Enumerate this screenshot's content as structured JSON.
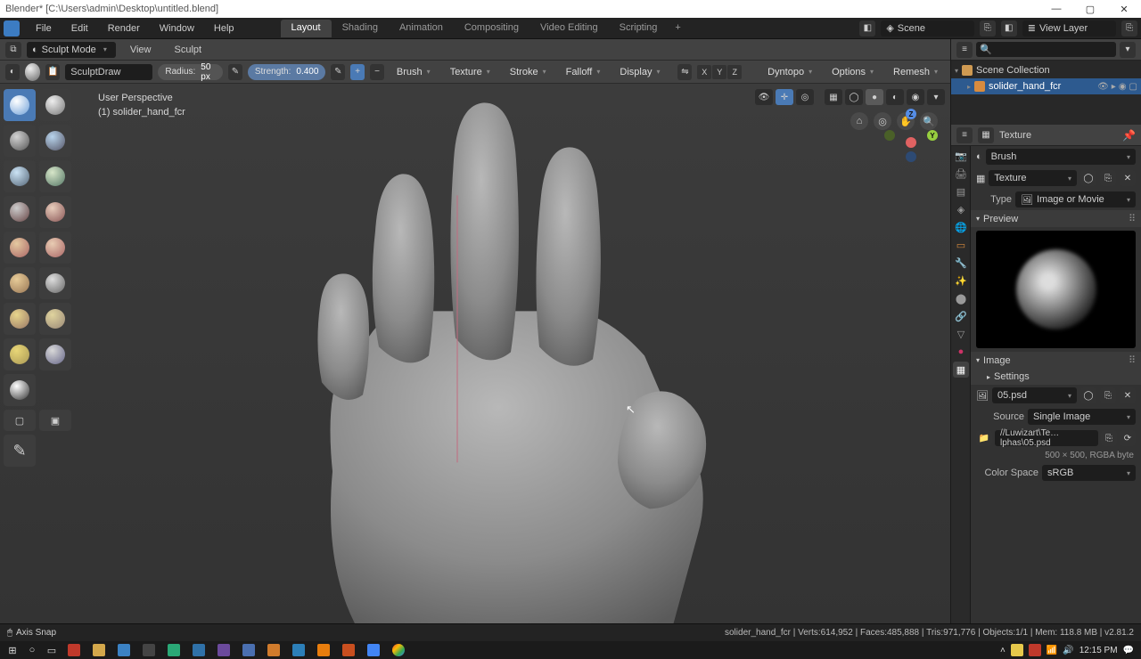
{
  "window": {
    "title": "Blender* [C:\\Users\\admin\\Desktop\\untitled.blend]"
  },
  "menu": [
    "File",
    "Edit",
    "Render",
    "Window",
    "Help"
  ],
  "workspaces": [
    "Layout",
    "Shading",
    "Animation",
    "Compositing",
    "Video Editing",
    "Scripting"
  ],
  "active_workspace": "Layout",
  "scene_field": "Scene",
  "viewlayer_field": "View Layer",
  "viewport": {
    "mode": "Sculpt Mode",
    "submenu": [
      "View",
      "Sculpt"
    ],
    "brush_name": "SculptDraw",
    "radius_label": "Radius:",
    "radius_value": "50 px",
    "strength_label": "Strength:",
    "strength_value": "0.400",
    "header_drops": [
      "Brush",
      "Texture",
      "Stroke",
      "Falloff",
      "Display"
    ],
    "right_drops": [
      "Dyntopo",
      "Options",
      "Remesh"
    ],
    "xyz": [
      "X",
      "Y",
      "Z"
    ],
    "info_line1": "User Perspective",
    "info_line2": "(1) solider_hand_fcr"
  },
  "outliner": {
    "root": "Scene Collection",
    "object": "solider_hand_fcr"
  },
  "props": {
    "title": "Texture",
    "brush_label": "Brush",
    "texture_label": "Texture",
    "type_label": "Type",
    "type_value": "Image or Movie",
    "preview_label": "Preview",
    "image_label": "Image",
    "settings_label": "Settings",
    "image_name": "05.psd",
    "source_label": "Source",
    "source_value": "Single Image",
    "filepath": "//Luwizart\\Te…lphas\\05.psd",
    "dims": "500 × 500,  RGBA byte",
    "colorspace_label": "Color Space",
    "colorspace_value": "sRGB"
  },
  "status": {
    "left": "Axis Snap",
    "right": "solider_hand_fcr | Verts:614,952 | Faces:485,888 | Tris:971,776 | Objects:1/1 | Mem: 118.8 MB | v2.81.2"
  },
  "taskbar": {
    "time": "12:15 PM"
  }
}
